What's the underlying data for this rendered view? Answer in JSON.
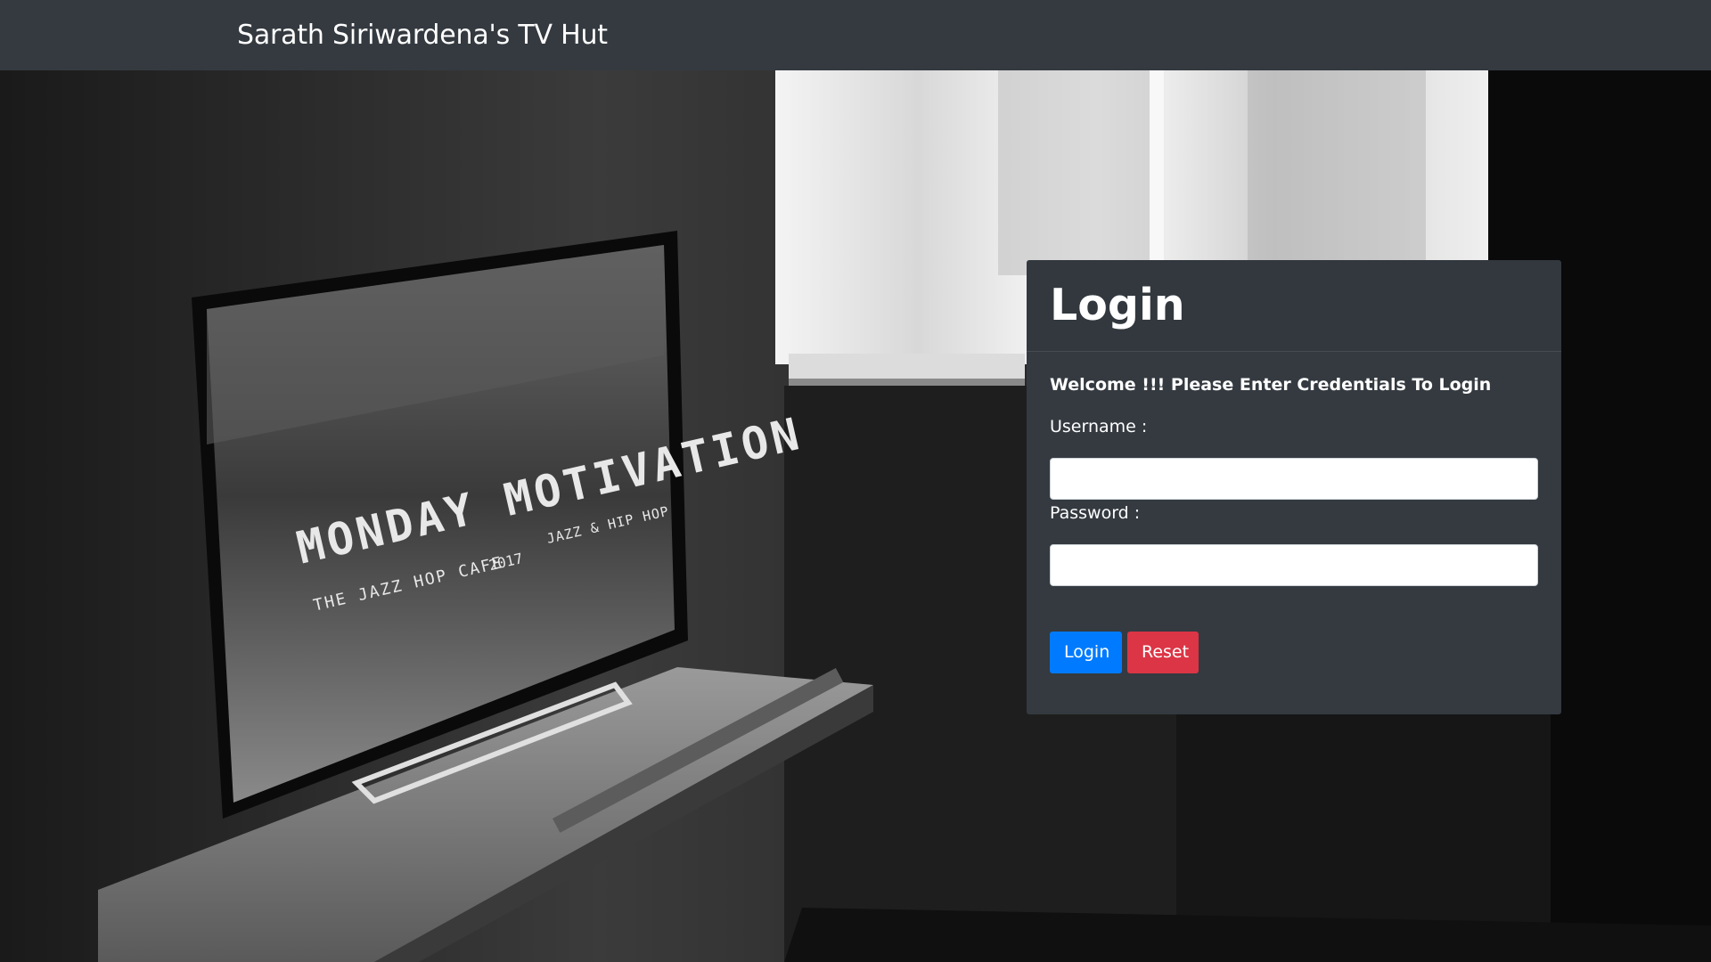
{
  "navbar": {
    "brand": "Sarath Siriwardena's TV Hut"
  },
  "background": {
    "tv_screen_text": {
      "headline": "MONDAY MOTIVATION",
      "subtitle": "THE JAZZ HOP CAFE",
      "year": "2017",
      "genre": "JAZZ & HIP HOP"
    }
  },
  "login": {
    "title": "Login",
    "welcome": "Welcome !!! Please Enter Credentials To Login",
    "username_label": "Username :",
    "username_value": "",
    "password_label": "Password :",
    "password_value": "",
    "login_button": "Login",
    "reset_button": "Reset"
  },
  "colors": {
    "navbar_bg": "#343a40",
    "card_bg": "#343a40",
    "login_button": "#007bff",
    "reset_button": "#dc3545"
  }
}
